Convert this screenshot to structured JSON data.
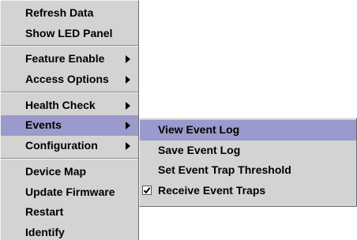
{
  "main_menu": {
    "items": [
      {
        "label": "Refresh Data"
      },
      {
        "label": "Show LED Panel"
      },
      {
        "label": "Feature Enable"
      },
      {
        "label": "Access Options"
      },
      {
        "label": "Health Check"
      },
      {
        "label": "Events"
      },
      {
        "label": "Configuration"
      },
      {
        "label": "Device Map"
      },
      {
        "label": "Update Firmware"
      },
      {
        "label": "Restart"
      },
      {
        "label": "Identify"
      }
    ]
  },
  "events_submenu": {
    "items": [
      {
        "label": "View Event Log"
      },
      {
        "label": "Save Event Log"
      },
      {
        "label": "Set Event Trap Threshold"
      },
      {
        "label": "Receive Event Traps",
        "checked": true
      }
    ]
  },
  "colors": {
    "menu_background": "#d3d3d3",
    "selection_highlight": "#9a9acc"
  },
  "icons": [
    "submenu-arrow-icon",
    "checkmark-icon"
  ]
}
